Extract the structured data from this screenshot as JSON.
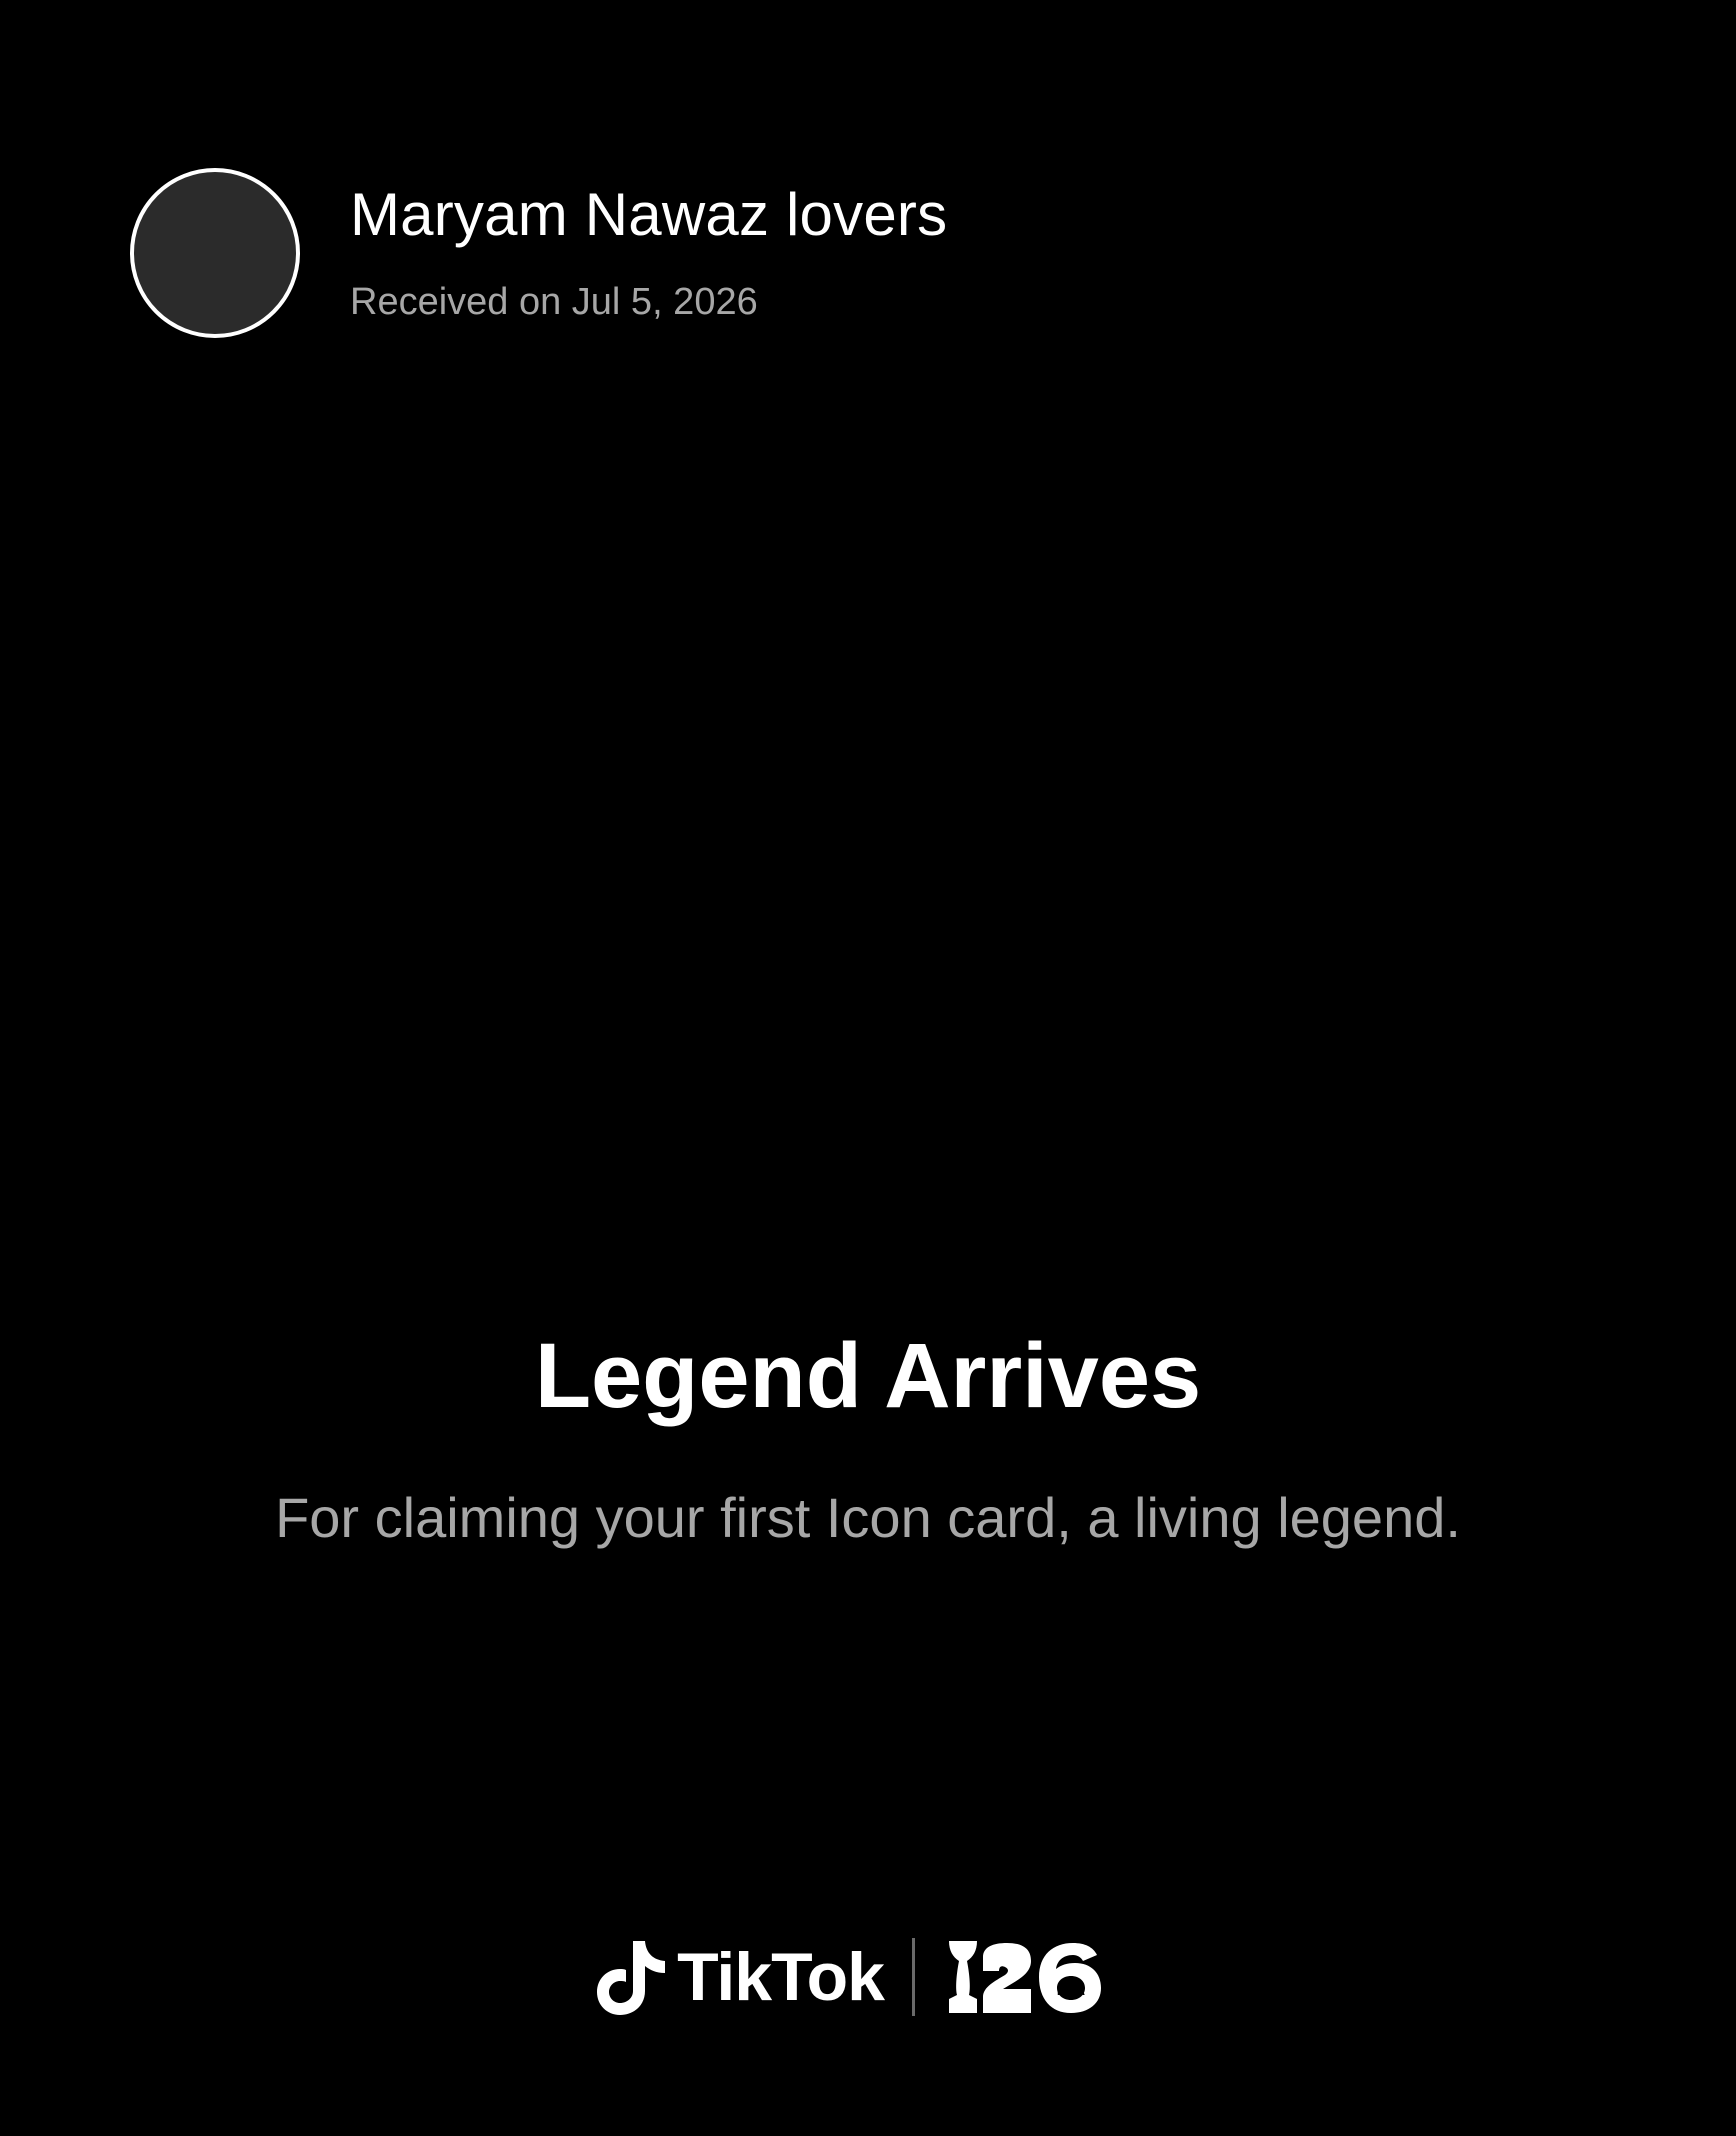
{
  "header": {
    "avatar_icon": "avatar",
    "username": "Maryam Nawaz lovers",
    "received": "Received on Jul 5, 2026"
  },
  "badge": {
    "title": "Legend Arrives",
    "description": "For claiming your first Icon card, a living legend."
  },
  "footer": {
    "brand_text": "TikTok",
    "brand_icon": "tiktok-note-icon",
    "partner_icon": "fifa-26-logo",
    "partner_text": "FIFA"
  },
  "colors": {
    "background": "#000000",
    "primary_text": "#ffffff",
    "secondary_text": "#a7a7a7",
    "avatar_fill": "#2b2b2b"
  }
}
